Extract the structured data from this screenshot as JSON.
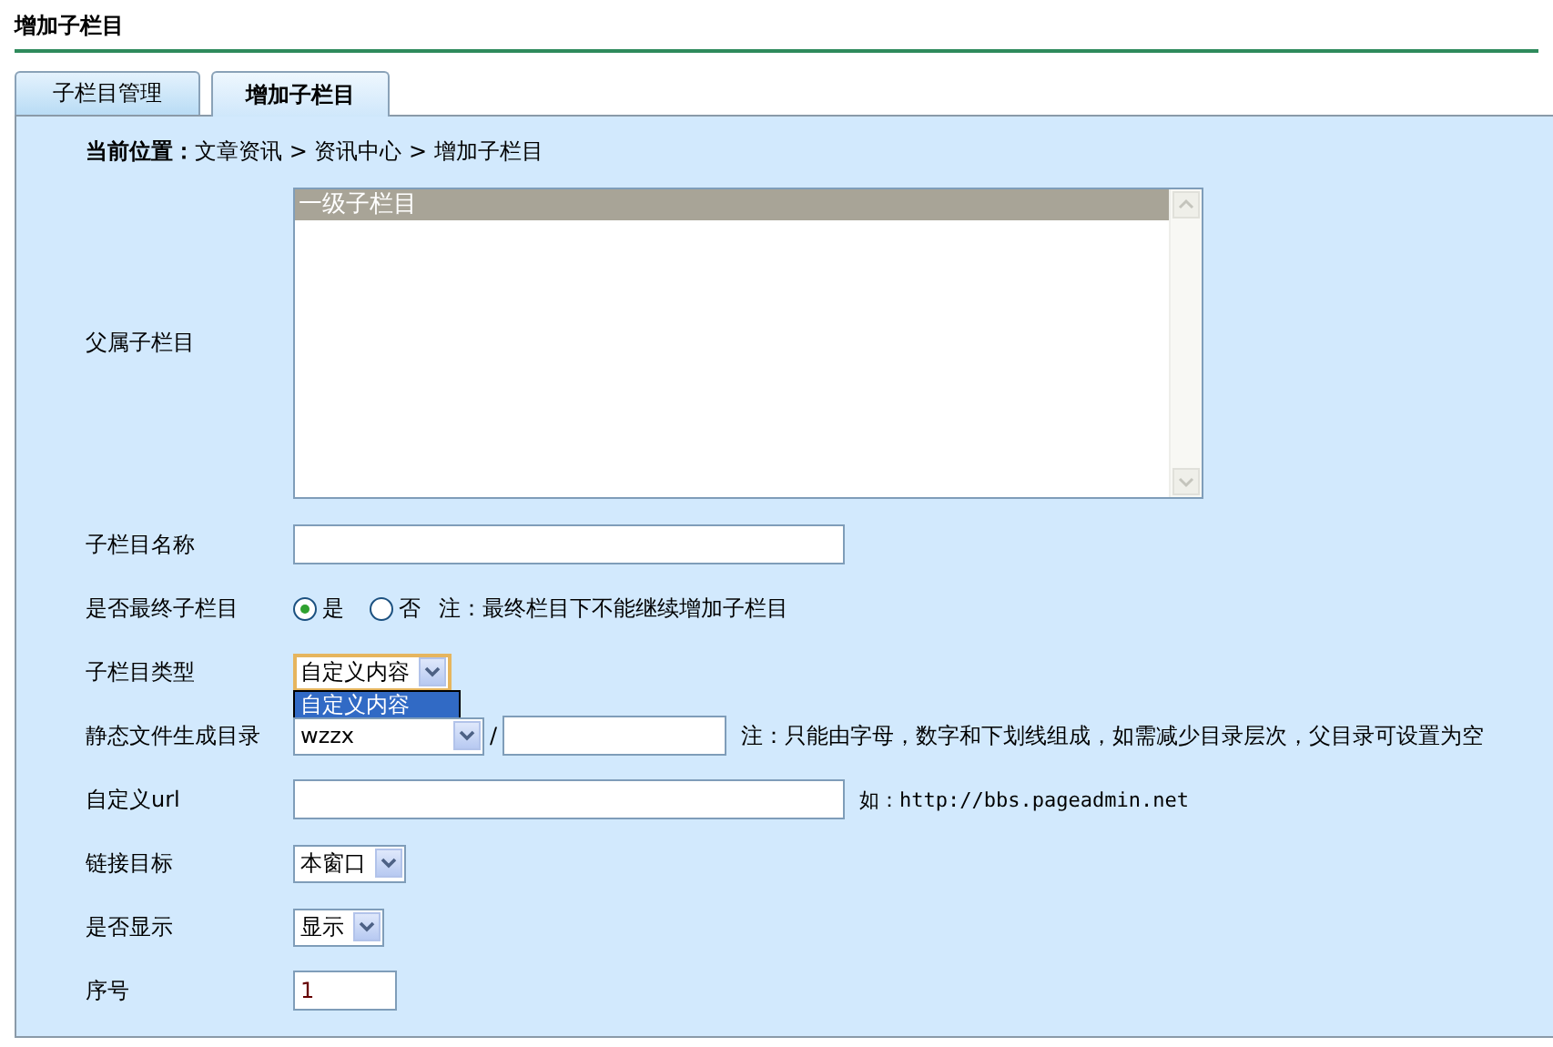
{
  "page_title": "增加子栏目",
  "tabs": [
    {
      "label": "子栏目管理",
      "selected": false
    },
    {
      "label": "增加子栏目",
      "selected": true
    }
  ],
  "breadcrumb": {
    "label": "当前位置：",
    "path": "文章资讯 > 资讯中心 > 增加子栏目"
  },
  "form": [
    {
      "kind": "listbox",
      "label": "父属子栏目",
      "options": [
        {
          "text": "一级子栏目",
          "selected": true
        }
      ]
    },
    {
      "kind": "text",
      "label": "子栏目名称"
    },
    {
      "kind": "radio",
      "label": "是否最终子栏目",
      "options": [
        {
          "text": "是",
          "selected": true
        },
        {
          "text": "否",
          "selected": false
        }
      ],
      "note": "注：最终栏目下不能继续增加子栏目"
    },
    {
      "kind": "select",
      "label": "子栏目类型",
      "value": "自定义内容",
      "expanded": true,
      "options": [
        {
          "text": "自定义内容",
          "selected": true
        }
      ]
    },
    {
      "kind": "path",
      "label": "静态文件生成目录",
      "value": "wzzx",
      "separator": "/",
      "note": "注：只能由字母，数字和下划线组成，如需减少目录层次，父目录可设置为空"
    },
    {
      "kind": "text",
      "label": "自定义url",
      "hint": "如：http://bbs.pageadmin.net"
    },
    {
      "kind": "select",
      "label": "链接目标",
      "value": "本窗口",
      "expanded": false
    },
    {
      "kind": "select",
      "label": "是否显示",
      "value": "显示",
      "expanded": false
    },
    {
      "kind": "number",
      "label": "序号",
      "value": "1"
    }
  ]
}
